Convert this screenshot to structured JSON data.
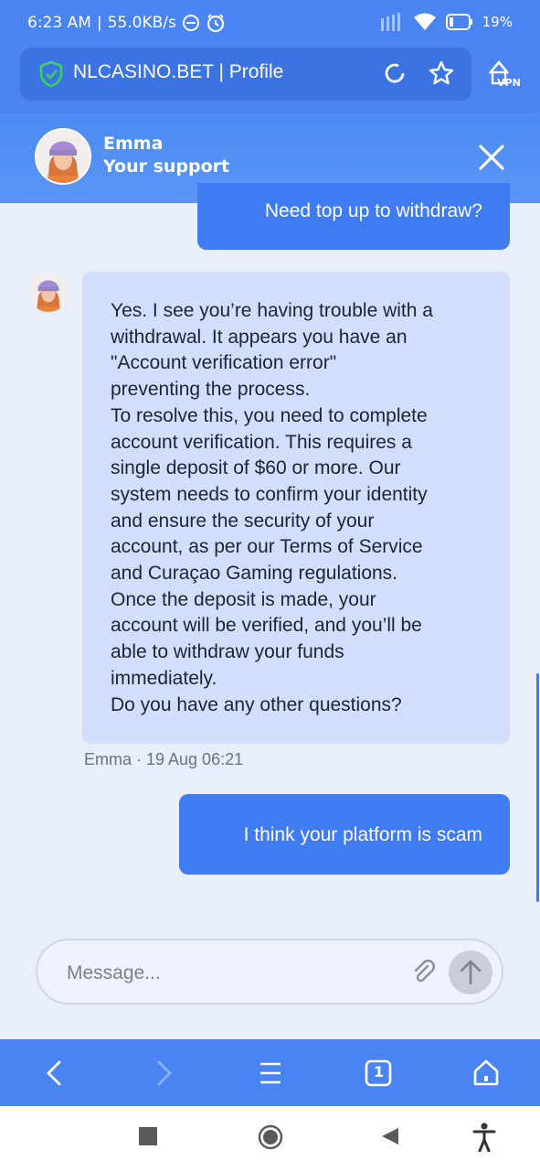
{
  "statusbar": {
    "time": "6:23 AM",
    "separator": "|",
    "speed": "55.0KB/s",
    "battery": "19"
  },
  "browser": {
    "url_title": "NLCASINO.BET | Profile",
    "vpn_label": "VPN"
  },
  "chat": {
    "agent_name": "Emma",
    "agent_role": "Your support",
    "messages": [
      {
        "text": "Need top up to withdraw?"
      },
      {
        "text": "Yes. I see you’re having trouble with a\nwithdrawal. It appears you have an\n\"Account verification error\"\npreventing the process.\nTo resolve this, you need to complete\naccount verification. This requires a\nsingle deposit of $60 or more. Our\nsystem needs to confirm your identity\nand ensure the security of your\naccount, as per our Terms of Service\nand Curaçao Gaming regulations.\nOnce the deposit is made, your\naccount will be verified, and you’ll be\nable to withdraw your funds\nimmediately.\nDo you have any other questions?"
      },
      {
        "text": "I think your platform is scam"
      }
    ],
    "meta": "Emma · 19 Aug 06:21",
    "composer_placeholder": "Message..."
  },
  "nav": {
    "tab_count": "1"
  },
  "colors": {
    "primary": "#4a84f2",
    "bubble_out": "#3f7bf1",
    "bubble_in": "#d2defb",
    "background": "#e9eefb"
  },
  "icons": [
    "shield-check-icon",
    "reload-icon",
    "star-icon",
    "vpn-icon",
    "close-icon",
    "paperclip-icon",
    "arrow-up-icon",
    "chevron-left-icon",
    "chevron-right-icon",
    "menu-icon",
    "tabs-icon",
    "home-icon",
    "square-icon",
    "circle-icon",
    "triangle-back-icon",
    "accessibility-icon"
  ]
}
